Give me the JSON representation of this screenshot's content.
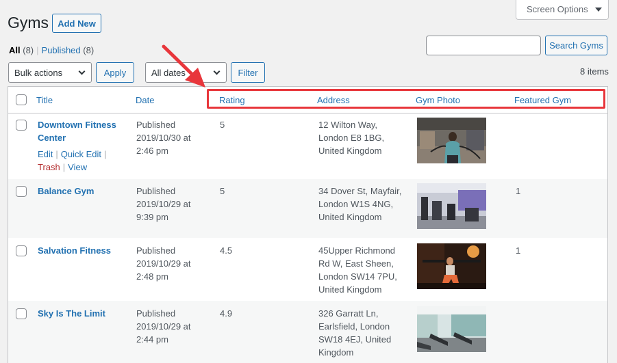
{
  "page": {
    "title": "Gyms",
    "add_new": "Add New",
    "screen_options": "Screen Options"
  },
  "filters": {
    "all_label": "All",
    "all_count": "(8)",
    "separator": "|",
    "published_label": "Published",
    "published_count": "(8)"
  },
  "search": {
    "placeholder": "",
    "button": "Search Gyms"
  },
  "bulk": {
    "actions_value": "Bulk actions",
    "apply": "Apply",
    "dates_value": "All dates",
    "filter": "Filter",
    "items_count": "8 items"
  },
  "columns": {
    "title": "Title",
    "date": "Date",
    "rating": "Rating",
    "address": "Address",
    "gym_photo": "Gym Photo",
    "featured_gym": "Featured Gym"
  },
  "rows": [
    {
      "title_line1": "Downtown Fitness",
      "title_line2": "Center",
      "status": "Published",
      "date": "2019/10/30 at",
      "time": "2:46 pm",
      "rating": "5",
      "address": [
        "12 Wilton Way,",
        "London E8 1BG,",
        "United Kingdom"
      ],
      "featured": "",
      "actions": {
        "edit": "Edit",
        "quick_edit": "Quick Edit",
        "trash": "Trash",
        "view": "View",
        "sep": "|"
      }
    },
    {
      "title_line1": "Balance Gym",
      "status": "Published",
      "date": "2019/10/29 at",
      "time": "9:39 pm",
      "rating": "5",
      "address": [
        "34 Dover St, Mayfair,",
        "London W1S 4NG,",
        "United Kingdom"
      ],
      "featured": "1"
    },
    {
      "title_line1": "Salvation Fitness",
      "status": "Published",
      "date": "2019/10/29 at",
      "time": "2:48 pm",
      "rating": "4.5",
      "address": [
        "45Upper Richmond",
        "Rd W, East Sheen,",
        "London SW14 7PU,",
        "United Kingdom"
      ],
      "featured": "1"
    },
    {
      "title_line1": "Sky Is The Limit",
      "status": "Published",
      "date": "2019/10/29 at",
      "time": "2:44 pm",
      "rating": "4.9",
      "address": [
        "326 Garratt Ln,",
        "Earlsfield, London",
        "SW18 4EJ, United",
        "Kingdom"
      ],
      "featured": ""
    }
  ],
  "colors": {
    "link": "#2271b1",
    "highlight": "#e8363b",
    "trash": "#b32d2e"
  }
}
